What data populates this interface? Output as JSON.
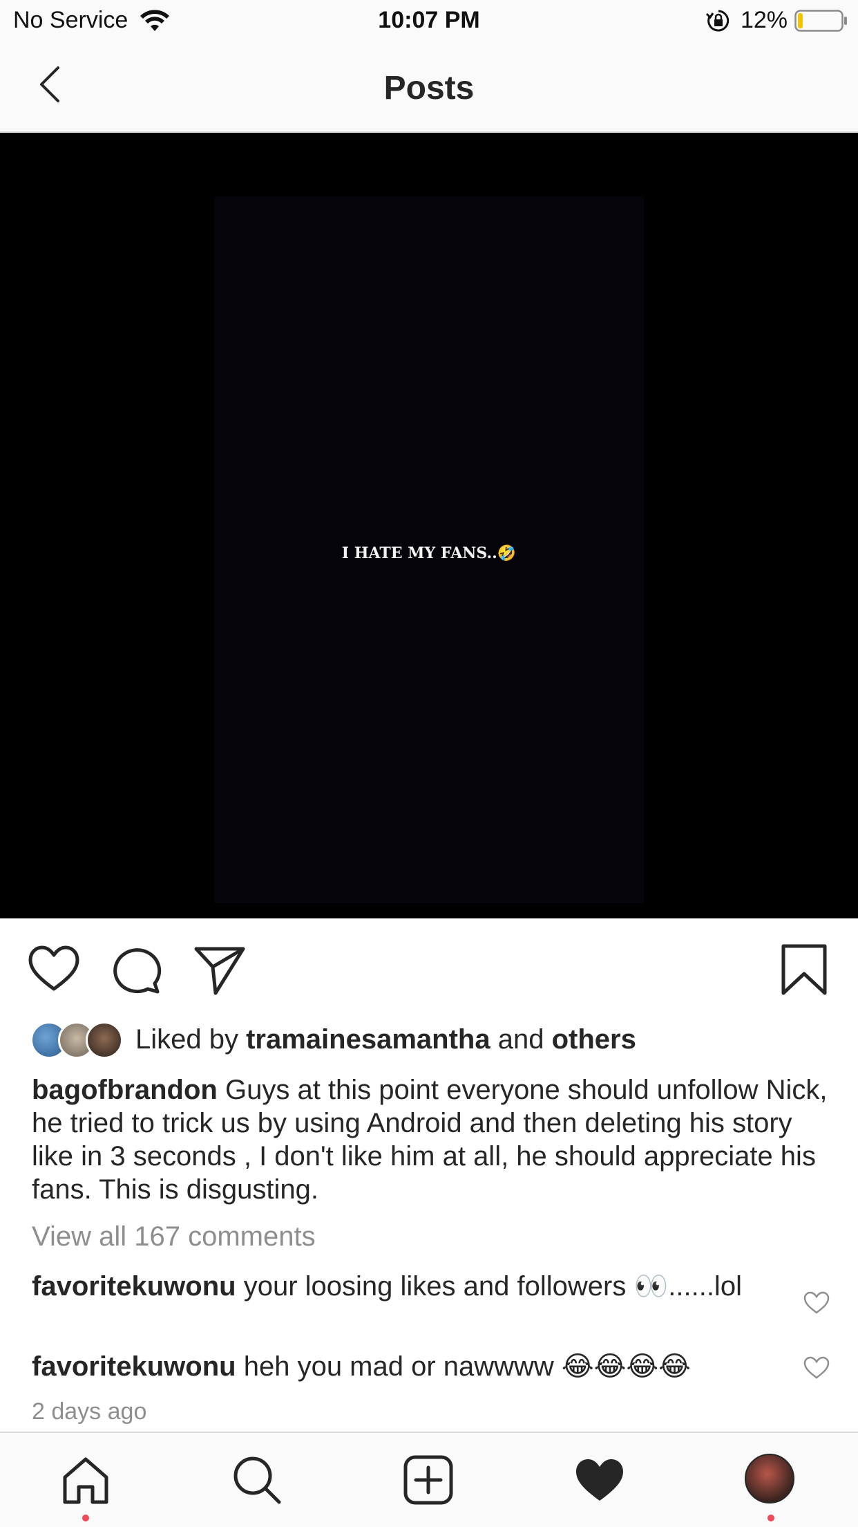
{
  "status_bar": {
    "carrier": "No Service",
    "time": "10:07 PM",
    "battery_percent": "12%",
    "battery_level": 0.12,
    "battery_color": "#f5c400"
  },
  "nav": {
    "title": "Posts",
    "back_icon": "chevron-left-icon"
  },
  "post": {
    "media_text": "I HATE MY FANS..",
    "media_emoji": "🤣",
    "likes": {
      "prefix": "Liked by",
      "user": "tramainesamantha",
      "middle": "and",
      "others": "others"
    },
    "caption": {
      "username": "bagofbrandon",
      "text": "Guys at this point everyone should unfollow Nick, he tried to trick us by using Android and then deleting his story like in 3 seconds , I don't like him at all, he should appreciate his fans. This is disgusting."
    },
    "view_all_comments": "View all 167 comments",
    "comments": [
      {
        "username": "favoritekuwonu",
        "text": "your loosing likes and followers 👀......lol"
      },
      {
        "username": "favoritekuwonu",
        "text": "heh you mad or nawwww 😂😂😂😂"
      }
    ],
    "timestamp": "2 days ago"
  },
  "tab_bar": {
    "items": [
      "home-icon",
      "search-icon",
      "new-post-icon",
      "activity-heart-icon",
      "profile-avatar"
    ]
  },
  "colors": {
    "notification_dot": "#ed4956",
    "secondary_text": "#8e8e8e"
  }
}
